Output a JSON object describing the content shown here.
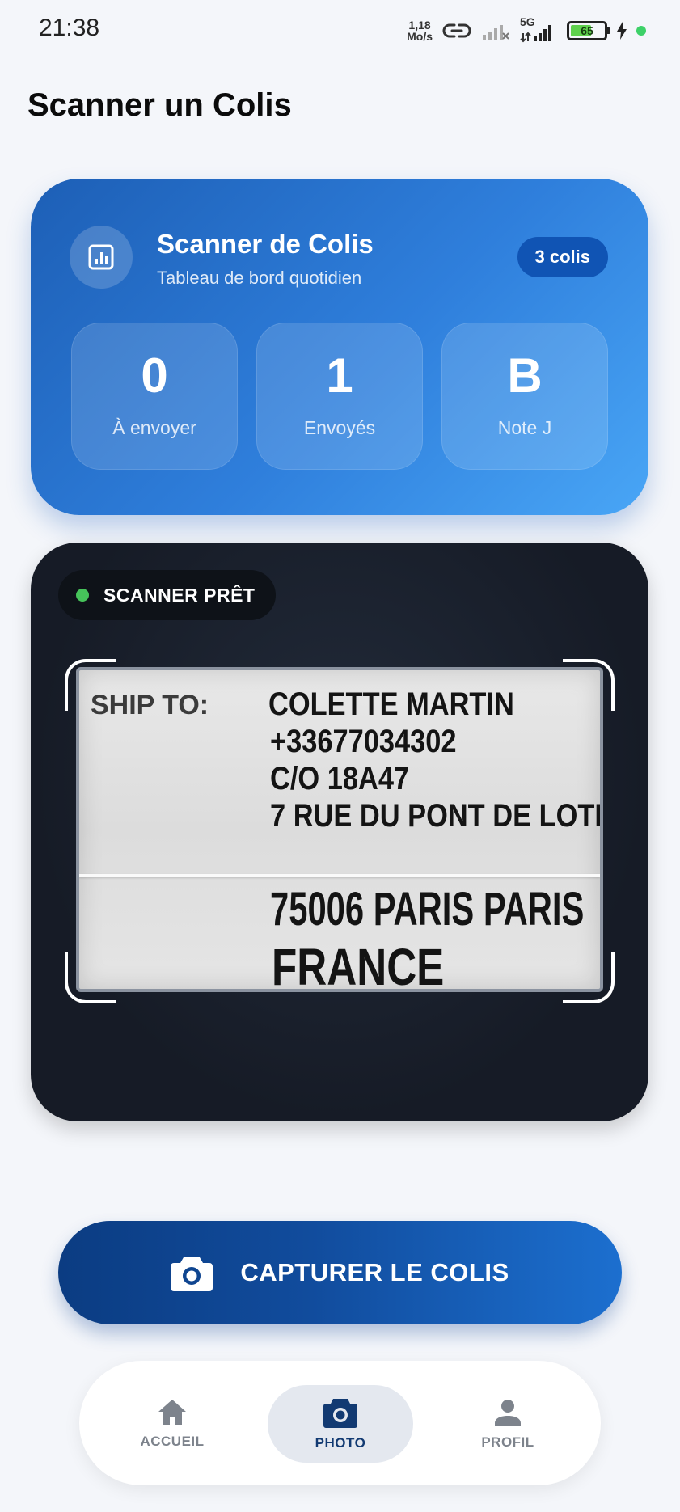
{
  "status_bar": {
    "time": "21:38",
    "net_speed_value": "1,18",
    "net_speed_unit": "Mo/s",
    "network_type": "5G",
    "battery_level": "65",
    "battery_percent": 65
  },
  "page": {
    "title": "Scanner un Colis"
  },
  "dashboard": {
    "icon": "chart-icon",
    "title": "Scanner de Colis",
    "subtitle": "Tableau de bord quotidien",
    "badge": "3 colis",
    "stats": [
      {
        "value": "0",
        "label": "À envoyer"
      },
      {
        "value": "1",
        "label": "Envoyés"
      },
      {
        "value": "B",
        "label": "Note J"
      }
    ]
  },
  "scanner": {
    "status": "SCANNER PRÊT",
    "label": {
      "ship_to": "SHIP TO:",
      "lines": [
        "COLETTE MARTIN",
        "+33677034302",
        "C/O 18A47",
        "7 RUE DU PONT DE LOTI",
        "75006 PARIS PARIS",
        "FRANCE"
      ]
    }
  },
  "capture_button": {
    "label": "CAPTURER LE COLIS",
    "icon": "camera-icon"
  },
  "nav": {
    "items": [
      {
        "label": "ACCUEIL",
        "icon": "home-icon",
        "active": false
      },
      {
        "label": "PHOTO",
        "icon": "camera-icon",
        "active": true
      },
      {
        "label": "PROFIL",
        "icon": "person-icon",
        "active": false
      }
    ]
  },
  "colors": {
    "primary": "#0b3c82",
    "accent": "#2f7fdc",
    "ready_dot": "#46c35a",
    "background": "#f4f6fa"
  }
}
